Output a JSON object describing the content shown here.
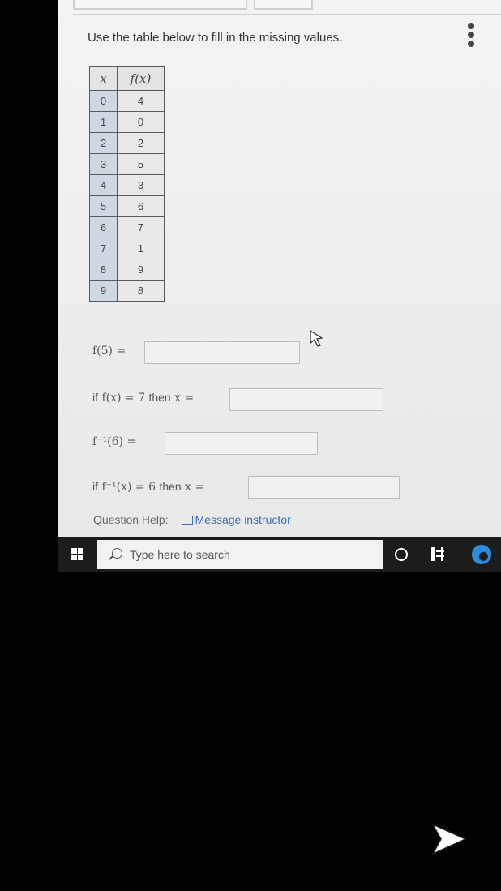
{
  "instruction": "Use the table below to fill in the missing values.",
  "table": {
    "headers": {
      "x": "x",
      "fx": "f(x)"
    },
    "rows": [
      {
        "x": "0",
        "fx": "4"
      },
      {
        "x": "1",
        "fx": "0"
      },
      {
        "x": "2",
        "fx": "2"
      },
      {
        "x": "3",
        "fx": "5"
      },
      {
        "x": "4",
        "fx": "3"
      },
      {
        "x": "5",
        "fx": "6"
      },
      {
        "x": "6",
        "fx": "7"
      },
      {
        "x": "7",
        "fx": "1"
      },
      {
        "x": "8",
        "fx": "9"
      },
      {
        "x": "9",
        "fx": "8"
      }
    ]
  },
  "questions": {
    "q1": {
      "label": "f(5) =",
      "value": ""
    },
    "q2": {
      "prefix": "if",
      "label": "f(x) = 7",
      "mid": "then",
      "rest": "x =",
      "value": ""
    },
    "q3": {
      "label": "f⁻¹(6) =",
      "value": ""
    },
    "q4": {
      "prefix": "if",
      "label": "f⁻¹(x) = 6",
      "mid": "then",
      "rest": "x =",
      "value": ""
    }
  },
  "help": {
    "label": "Question Help:",
    "link": "Message instructor"
  },
  "taskbar": {
    "search_placeholder": "Type here to search"
  },
  "icons": [
    "more-vertical-icon",
    "mail-icon",
    "windows-start-icon",
    "search-icon",
    "cortana-icon",
    "task-view-icon",
    "edge-icon",
    "mouse-cursor-icon",
    "next-arrow-icon"
  ],
  "colors": {
    "x_column": "#cfd7e0",
    "link": "#3b6dbd",
    "taskbar": "#1c1c1c"
  }
}
